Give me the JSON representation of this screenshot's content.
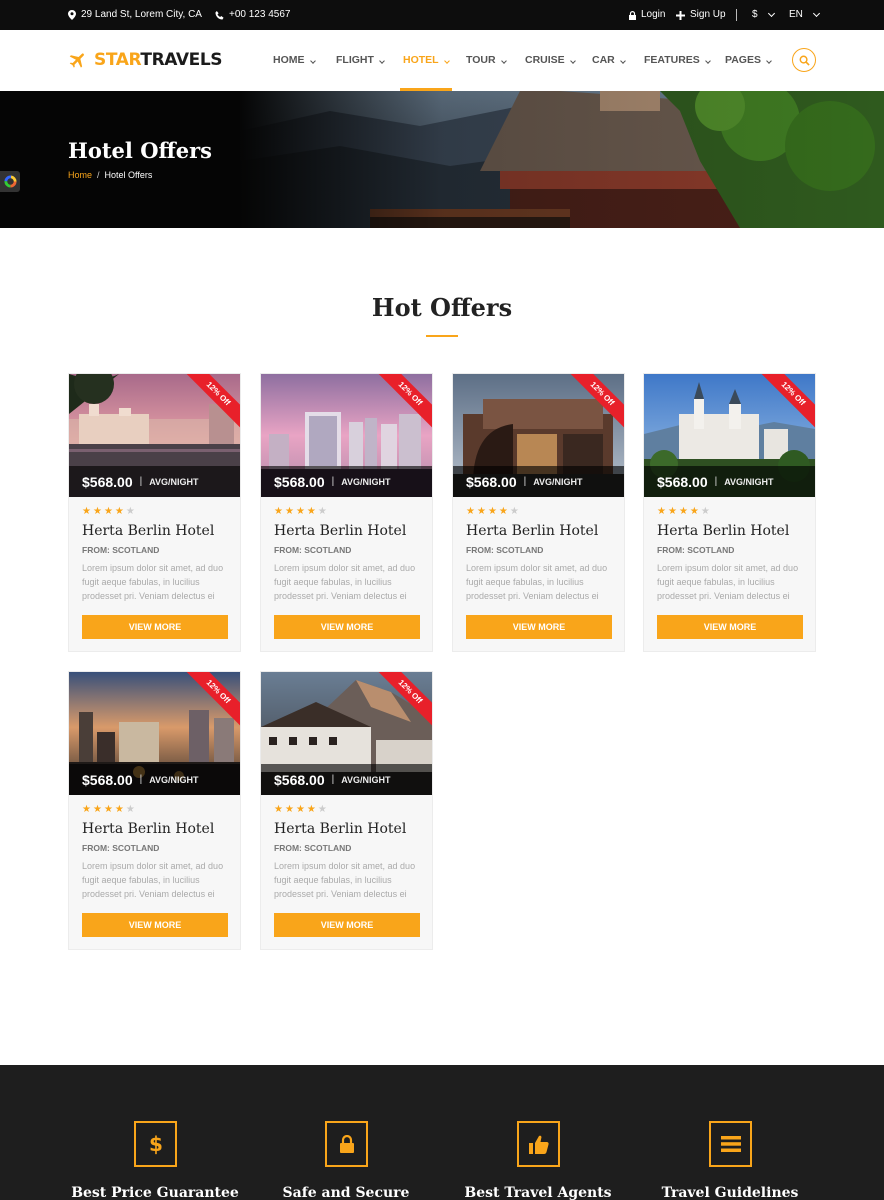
{
  "topbar": {
    "address": "29 Land St, Lorem City, CA",
    "phone": "+00 123 4567",
    "login": "Login",
    "signup": "Sign Up",
    "currency": "$",
    "language": "EN"
  },
  "header": {
    "logo_star": "STAR",
    "logo_travels": "TRAVELS",
    "nav": [
      "HOME",
      "FLIGHT",
      "HOTEL",
      "TOUR",
      "CRUISE",
      "CAR",
      "FEATURES",
      "PAGES"
    ],
    "active_nav": "HOTEL"
  },
  "hero": {
    "title": "Hotel Offers",
    "breadcrumb_home": "Home",
    "breadcrumb_current": "Hotel Offers"
  },
  "section": {
    "title": "Hot Offers"
  },
  "cards": [
    {
      "ribbon": "12% Off",
      "price": "$568.00",
      "per": "AVG/NIGHT",
      "rating": 4,
      "name": "Herta Berlin Hotel",
      "from": "FROM: SCOTLAND",
      "desc": "Lorem ipsum dolor sit amet, ad duo fugit aeque fabulas, in lucilius prodesset pri. Veniam delectus ei",
      "button": "VIEW MORE",
      "image": "city-sunset"
    },
    {
      "ribbon": "12% Off",
      "price": "$568.00",
      "per": "AVG/NIGHT",
      "rating": 4,
      "name": "Herta Berlin Hotel",
      "from": "FROM: SCOTLAND",
      "desc": "Lorem ipsum dolor sit amet, ad duo fugit aeque fabulas, in lucilius prodesset pri. Veniam delectus ei",
      "button": "VIEW MORE",
      "image": "pink-skyline"
    },
    {
      "ribbon": "12% Off",
      "price": "$568.00",
      "per": "AVG/NIGHT",
      "rating": 4,
      "name": "Herta Berlin Hotel",
      "from": "FROM: SCOTLAND",
      "desc": "Lorem ipsum dolor sit amet, ad duo fugit aeque fabulas, in lucilius prodesset pri. Veniam delectus ei",
      "button": "VIEW MORE",
      "image": "modern-building"
    },
    {
      "ribbon": "12% Off",
      "price": "$568.00",
      "per": "AVG/NIGHT",
      "rating": 4,
      "name": "Herta Berlin Hotel",
      "from": "FROM: SCOTLAND",
      "desc": "Lorem ipsum dolor sit amet, ad duo fugit aeque fabulas, in lucilius prodesset pri. Veniam delectus ei",
      "button": "VIEW MORE",
      "image": "castle"
    },
    {
      "ribbon": "12% Off",
      "price": "$568.00",
      "per": "AVG/NIGHT",
      "rating": 4,
      "name": "Herta Berlin Hotel",
      "from": "FROM: SCOTLAND",
      "desc": "Lorem ipsum dolor sit amet, ad duo fugit aeque fabulas, in lucilius prodesset pri. Veniam delectus ei",
      "button": "VIEW MORE",
      "image": "city-dusk"
    },
    {
      "ribbon": "12% Off",
      "price": "$568.00",
      "per": "AVG/NIGHT",
      "rating": 4,
      "name": "Herta Berlin Hotel",
      "from": "FROM: SCOTLAND",
      "desc": "Lorem ipsum dolor sit amet, ad duo fugit aeque fabulas, in lucilius prodesset pri. Veniam delectus ei",
      "button": "VIEW MORE",
      "image": "mountain-chalet"
    }
  ],
  "features": [
    {
      "title": "Best Price Guarantee",
      "icon": "dollar-icon"
    },
    {
      "title": "Safe and Secure",
      "icon": "lock-icon"
    },
    {
      "title": "Best Travel Agents",
      "icon": "thumbs-up-icon"
    },
    {
      "title": "Travel Guidelines",
      "icon": "list-icon"
    }
  ],
  "colors": {
    "accent": "#f9a51a",
    "ribbon": "#e8202a",
    "topbar": "#0d0d0d",
    "footer": "#1e1e1e"
  }
}
